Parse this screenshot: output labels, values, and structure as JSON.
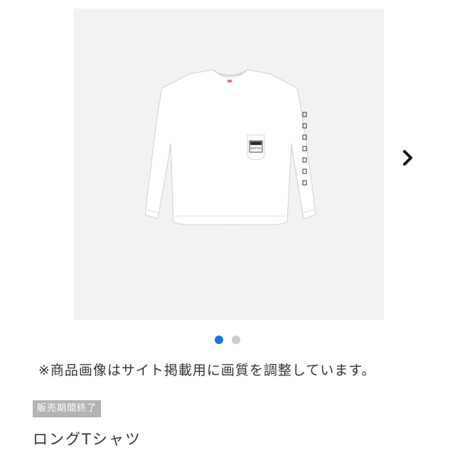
{
  "gallery": {
    "image_alt": "product-image-long-sleeve-pocket-tee",
    "pocket_label": "DATCH",
    "next_icon": "chevron-right-icon",
    "dots": [
      {
        "state": "active",
        "color": "#1a73e8"
      },
      {
        "state": "inactive",
        "color": "#cccccc"
      }
    ],
    "current_index": 1,
    "total": 2
  },
  "notice": {
    "text": "※商品画像はサイト掲載用に画質を調整しています。"
  },
  "status_badge": {
    "text": "販売期間終了",
    "color": "#b3b3b3"
  },
  "product": {
    "name": "ロングTシャツ"
  }
}
